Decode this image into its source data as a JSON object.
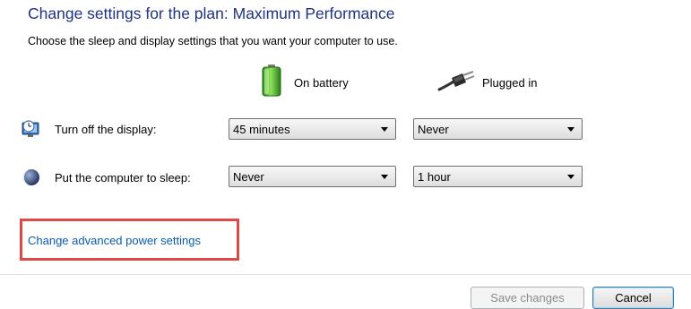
{
  "header": {
    "title": "Change settings for the plan: Maximum Performance",
    "subtitle": "Choose the sleep and display settings that you want your computer to use."
  },
  "columns": {
    "battery_label": "On battery",
    "plugged_label": "Plugged in"
  },
  "settings": [
    {
      "label": "Turn off the display:",
      "icon": "monitor-clock-icon",
      "on_battery": "45 minutes",
      "plugged_in": "Never"
    },
    {
      "label": "Put the computer to sleep:",
      "icon": "moon-icon",
      "on_battery": "Never",
      "plugged_in": "1 hour"
    }
  ],
  "advanced_link": "Change advanced power settings",
  "buttons": {
    "save": "Save changes",
    "cancel": "Cancel"
  },
  "colors": {
    "title": "#1e3287",
    "link": "#0a5bb3",
    "highlight_box": "#e04848"
  }
}
